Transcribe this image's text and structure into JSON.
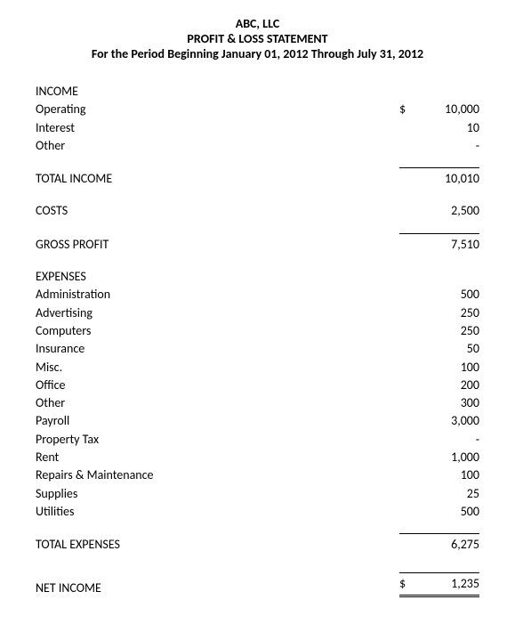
{
  "header": {
    "company": "ABC, LLC",
    "title": "PROFIT & LOSS STATEMENT",
    "period": "For the Period Beginning January 01, 2012 Through  July 31, 2012"
  },
  "currency": "$",
  "income": {
    "section_label": "INCOME",
    "items": [
      {
        "label": "Operating",
        "value": "10,000",
        "currency": true
      },
      {
        "label": "Interest",
        "value": "10"
      },
      {
        "label": "Other",
        "value": "-"
      }
    ],
    "total_label": "TOTAL INCOME",
    "total_value": "10,010"
  },
  "costs": {
    "label": "COSTS",
    "value": "2,500"
  },
  "gross_profit": {
    "label": "GROSS PROFIT",
    "value": "7,510"
  },
  "expenses": {
    "section_label": "EXPENSES",
    "items": [
      {
        "label": "Administration",
        "value": "500"
      },
      {
        "label": "Advertising",
        "value": "250"
      },
      {
        "label": "Computers",
        "value": "250"
      },
      {
        "label": "Insurance",
        "value": "50"
      },
      {
        "label": "Misc.",
        "value": "100"
      },
      {
        "label": "Office",
        "value": "200"
      },
      {
        "label": "Other",
        "value": "300"
      },
      {
        "label": "Payroll",
        "value": "3,000"
      },
      {
        "label": "Property Tax",
        "value": "-"
      },
      {
        "label": "Rent",
        "value": "1,000"
      },
      {
        "label": "Repairs & Maintenance",
        "value": "100"
      },
      {
        "label": "Supplies",
        "value": "25"
      },
      {
        "label": "Utilities",
        "value": "500"
      }
    ],
    "total_label": "TOTAL EXPENSES",
    "total_value": "6,275"
  },
  "net_income": {
    "label": "NET INCOME",
    "value": "1,235",
    "currency": true
  }
}
